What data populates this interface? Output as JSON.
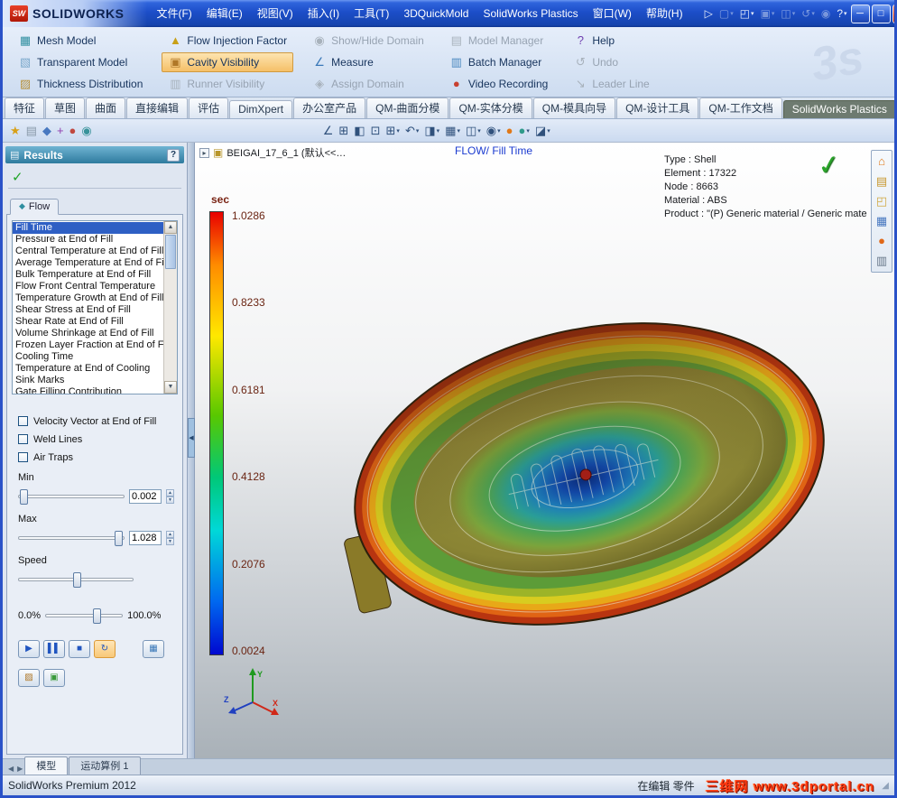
{
  "caret_glyph": "▾",
  "ds_logo": "3s",
  "window": {
    "logo_badge": "SW",
    "app_name": "SOLIDWORKS",
    "menus": [
      "文件(F)",
      "编辑(E)",
      "视图(V)",
      "插入(I)",
      "工具(T)",
      "3DQuickMold",
      "SolidWorks Plastics",
      "窗口(W)",
      "帮助(H)"
    ],
    "controls": {
      "minimize": "─",
      "maximize": "□",
      "close": "✕"
    },
    "toolbar_icons": [
      {
        "name": "send-feedback-icon",
        "glyph": "▷",
        "dim": false,
        "caret": false
      },
      {
        "name": "new-document-icon",
        "glyph": "▢",
        "dim": true,
        "caret": true
      },
      {
        "name": "open-document-icon",
        "glyph": "◰",
        "dim": false,
        "caret": true
      },
      {
        "name": "save-icon",
        "glyph": "▣",
        "dim": true,
        "caret": true
      },
      {
        "name": "print-icon",
        "glyph": "◫",
        "dim": true,
        "caret": true
      },
      {
        "name": "undo-icon",
        "glyph": "↺",
        "dim": true,
        "caret": true
      },
      {
        "name": "rebuild-icon",
        "glyph": "◉",
        "dim": true,
        "caret": false
      },
      {
        "name": "options-icon",
        "glyph": "?",
        "dim": false,
        "caret": true
      }
    ]
  },
  "ribbon": {
    "columns": [
      {
        "items": [
          {
            "label": "Mesh Model",
            "state": "normal",
            "glyph": "▦",
            "color": "#2f8fa0"
          },
          {
            "label": "Transparent Model",
            "state": "normal",
            "glyph": "▧",
            "color": "#7aa8cc"
          },
          {
            "label": "Thickness Distribution",
            "state": "normal",
            "glyph": "▨",
            "color": "#b89038"
          }
        ]
      },
      {
        "items": [
          {
            "label": "Flow Injection Factor",
            "state": "normal",
            "glyph": "▲",
            "color": "#c8a018"
          },
          {
            "label": "Cavity Visibility",
            "state": "active",
            "glyph": "▣",
            "color": "#b07828"
          },
          {
            "label": "Runner Visibility",
            "state": "disabled",
            "glyph": "▥",
            "color": "#9aa4ae"
          }
        ]
      },
      {
        "items": [
          {
            "label": "Show/Hide Domain",
            "state": "disabled",
            "glyph": "◉",
            "color": "#9aa4ae"
          },
          {
            "label": "Measure",
            "state": "normal",
            "glyph": "∠",
            "color": "#3a78b8"
          },
          {
            "label": "Assign Domain",
            "state": "disabled",
            "glyph": "◈",
            "color": "#9aa4ae"
          }
        ]
      },
      {
        "items": [
          {
            "label": "Model Manager",
            "state": "disabled",
            "glyph": "▤",
            "color": "#9aa4ae"
          },
          {
            "label": "Batch Manager",
            "state": "normal",
            "glyph": "▥",
            "color": "#4a88c0"
          },
          {
            "label": "Video Recording",
            "state": "normal",
            "glyph": "●",
            "color": "#c84030"
          }
        ]
      },
      {
        "items": [
          {
            "label": "Help",
            "state": "normal",
            "glyph": "?",
            "color": "#7040b0"
          },
          {
            "label": "Undo",
            "state": "disabled",
            "glyph": "↺",
            "color": "#9aa4ae"
          },
          {
            "label": "Leader Line",
            "state": "disabled",
            "glyph": "↘",
            "color": "#9aa4ae"
          }
        ]
      }
    ]
  },
  "tabs": {
    "items": [
      "特征",
      "草图",
      "曲面",
      "直接编辑",
      "评估",
      "DimXpert",
      "办公室产品",
      "QM-曲面分模",
      "QM-实体分模",
      "QM-模具向导",
      "QM-设计工具",
      "QM-工作文档"
    ],
    "active": "SolidWorks Plastics"
  },
  "toolbar_row": {
    "panel_tabs": [
      {
        "name": "propertymanager-tab-icon",
        "glyph": "★",
        "color": "#d8a018"
      },
      {
        "name": "featuremanager-tab-icon",
        "glyph": "▤",
        "color": "#8898a8"
      },
      {
        "name": "configurationmanager-tab-icon",
        "glyph": "◆",
        "color": "#4878c0"
      },
      {
        "name": "dimxpertmanager-tab-icon",
        "glyph": "+",
        "color": "#9040b0"
      },
      {
        "name": "displaymanager-tab-icon",
        "glyph": "●",
        "color": "#c04840"
      },
      {
        "name": "plastics-manager-tab-icon",
        "glyph": "◉",
        "color": "#38929a"
      }
    ],
    "view_tools": [
      {
        "name": "measure-icon",
        "glyph": "∠",
        "caret": false
      },
      {
        "name": "mass-properties-icon",
        "glyph": "⊞",
        "caret": false
      },
      {
        "name": "section-view-icon",
        "glyph": "◧",
        "caret": false
      },
      {
        "name": "zoom-fit-icon",
        "glyph": "⊡",
        "caret": false
      },
      {
        "name": "zoom-area-icon",
        "glyph": "⊞",
        "caret": true
      },
      {
        "name": "previous-view-icon",
        "glyph": "↶",
        "caret": true
      },
      {
        "name": "section-tool-icon",
        "glyph": "◨",
        "caret": true
      },
      {
        "name": "view-orientation-icon",
        "glyph": "▦",
        "caret": true
      },
      {
        "name": "display-style-icon",
        "glyph": "◫",
        "caret": true
      },
      {
        "name": "hide-show-items-icon",
        "glyph": "◉",
        "caret": true
      },
      {
        "name": "edit-appearance-icon",
        "glyph": "●",
        "color": "#e07818",
        "caret": false
      },
      {
        "name": "apply-scene-icon",
        "glyph": "●",
        "color": "#2f9a8a",
        "caret": true
      },
      {
        "name": "view-settings-icon",
        "glyph": "◪",
        "caret": true
      }
    ]
  },
  "results_panel": {
    "title": "Results",
    "help": "?",
    "ok_glyph": "✓",
    "tab": "Flow",
    "tab_icon": "◆",
    "list": [
      "Fill Time",
      "Pressure at End of Fill",
      "Central Temperature at End of Fill",
      "Average Temperature at End of Fill",
      "Bulk Temperature at End of Fill",
      "Flow Front Central Temperature",
      "Temperature Growth at End of Fill",
      "Shear Stress at End of Fill",
      "Shear Rate at End of Fill",
      "Volume Shrinkage at End of Fill",
      "Frozen Layer Fraction at End of Fill",
      "Cooling Time",
      "Temperature at End of Cooling",
      "Sink Marks",
      "Gate Filling Contribution"
    ],
    "selected": "Fill Time",
    "checkboxes": [
      "Velocity Vector at End of Fill",
      "Weld Lines",
      "Air Traps"
    ],
    "min_label": "Min",
    "min_value": "0.002",
    "max_label": "Max",
    "max_value": "1.028",
    "speed_label": "Speed",
    "range_left": "0.0%",
    "range_right": "100.0%",
    "spin_up": "▲",
    "spin_down": "▼",
    "scroll_up": "▲",
    "scroll_down": "▼",
    "player": [
      {
        "name": "play-button",
        "glyph": "▶",
        "active": false
      },
      {
        "name": "pause-button",
        "glyph": "▌▌",
        "active": false
      },
      {
        "name": "stop-button",
        "glyph": "■",
        "active": false
      },
      {
        "name": "loop-button",
        "glyph": "↻",
        "active": true
      }
    ],
    "extra_buttons": [
      {
        "name": "save-animation-button",
        "glyph": "▦",
        "color": "#3a78b8"
      }
    ],
    "extra_buttons2": [
      {
        "name": "plot-settings-button",
        "glyph": "▨",
        "color": "#b07828"
      },
      {
        "name": "save-image-button",
        "glyph": "▣",
        "color": "#3a9a3a"
      }
    ]
  },
  "panel_splitter_glyph": "◀",
  "viewport": {
    "tree_expander": "▸",
    "tree_icon": "▣",
    "tree_label": "BEIGAI_17_6_1 (默认<<…",
    "overlay_title": "FLOW/ Fill Time",
    "info": [
      "Type : Shell",
      "Element : 17322",
      "Node : 8663",
      "Material : ABS",
      "Product :  \"(P)  Generic material / Generic mate"
    ],
    "check_glyph": "✓",
    "legend": {
      "unit": "sec",
      "values": [
        "1.0286",
        "0.8233",
        "0.6181",
        "0.4128",
        "0.2076",
        "0.0024"
      ]
    },
    "triad": {
      "y": "Y",
      "x": "X",
      "z": "Z"
    }
  },
  "taskpane": [
    {
      "name": "resources-home-icon",
      "glyph": "⌂",
      "color": "#e07818"
    },
    {
      "name": "design-library-icon",
      "glyph": "▤",
      "color": "#c89830"
    },
    {
      "name": "file-explorer-icon",
      "glyph": "◰",
      "color": "#d0a840"
    },
    {
      "name": "view-palette-icon",
      "glyph": "▦",
      "color": "#4878c0"
    },
    {
      "name": "appearances-icon",
      "glyph": "●",
      "color": "#e06818"
    },
    {
      "name": "custom-properties-icon",
      "glyph": "▥",
      "color": "#68788a"
    }
  ],
  "bottom_tabs": {
    "nav_left": "◀",
    "nav_right": "▶",
    "items": [
      "模型",
      "运动算例 1"
    ],
    "active": "模型"
  },
  "status_bar": {
    "left": "SolidWorks Premium 2012",
    "edit_status": "在编辑 零件",
    "watermark": "三维网 www.3dportal.cn",
    "grip": "◢"
  }
}
